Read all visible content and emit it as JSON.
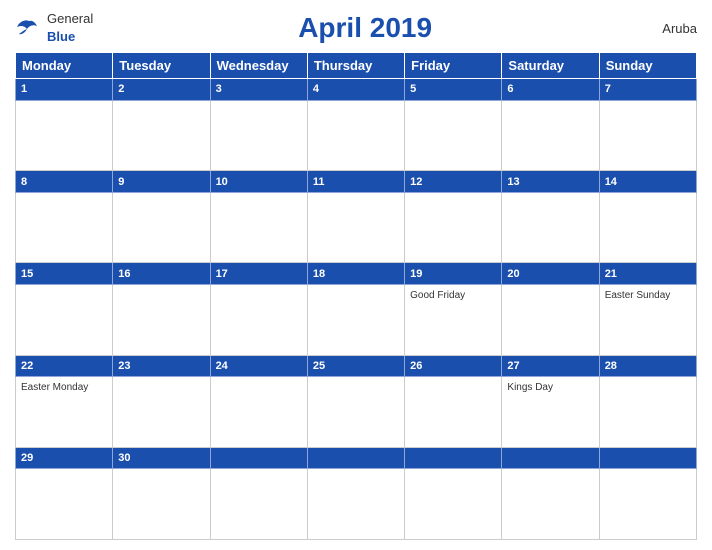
{
  "header": {
    "logo_general": "General",
    "logo_blue": "Blue",
    "title": "April 2019",
    "country": "Aruba"
  },
  "days": [
    "Monday",
    "Tuesday",
    "Wednesday",
    "Thursday",
    "Friday",
    "Saturday",
    "Sunday"
  ],
  "weeks": [
    {
      "numbers": [
        "1",
        "2",
        "3",
        "4",
        "5",
        "6",
        "7"
      ],
      "holidays": [
        "",
        "",
        "",
        "",
        "",
        "",
        ""
      ]
    },
    {
      "numbers": [
        "8",
        "9",
        "10",
        "11",
        "12",
        "13",
        "14"
      ],
      "holidays": [
        "",
        "",
        "",
        "",
        "",
        "",
        ""
      ]
    },
    {
      "numbers": [
        "15",
        "16",
        "17",
        "18",
        "19",
        "20",
        "21"
      ],
      "holidays": [
        "",
        "",
        "",
        "",
        "Good Friday",
        "",
        "Easter Sunday"
      ]
    },
    {
      "numbers": [
        "22",
        "23",
        "24",
        "25",
        "26",
        "27",
        "28"
      ],
      "holidays": [
        "Easter Monday",
        "",
        "",
        "",
        "",
        "Kings Day",
        ""
      ]
    },
    {
      "numbers": [
        "29",
        "30",
        "",
        "",
        "",
        "",
        ""
      ],
      "holidays": [
        "",
        "",
        "",
        "",
        "",
        "",
        ""
      ]
    }
  ]
}
